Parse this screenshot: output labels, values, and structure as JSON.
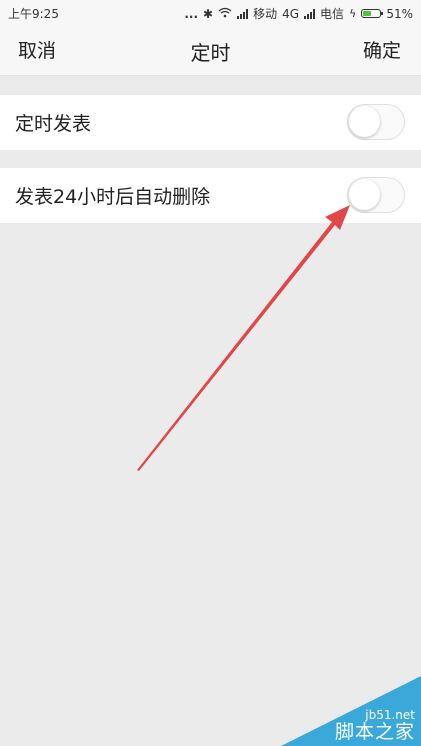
{
  "status_bar": {
    "time": "上午9:25",
    "dots": "...",
    "carrier1": "移动",
    "network": "4G",
    "carrier2": "电信",
    "battery": "51%",
    "battery_level": 0.51,
    "battery_color": "#4cc53a"
  },
  "nav": {
    "cancel": "取消",
    "title": "定时",
    "confirm": "确定"
  },
  "settings": [
    {
      "label": "定时发表",
      "enabled": false
    },
    {
      "label": "发表24小时后自动删除",
      "enabled": false
    }
  ],
  "annotation": {
    "color": "#e04848"
  },
  "watermark": {
    "url": "jb51.net",
    "text": "脚本之家",
    "color": "#3aa8d8"
  }
}
